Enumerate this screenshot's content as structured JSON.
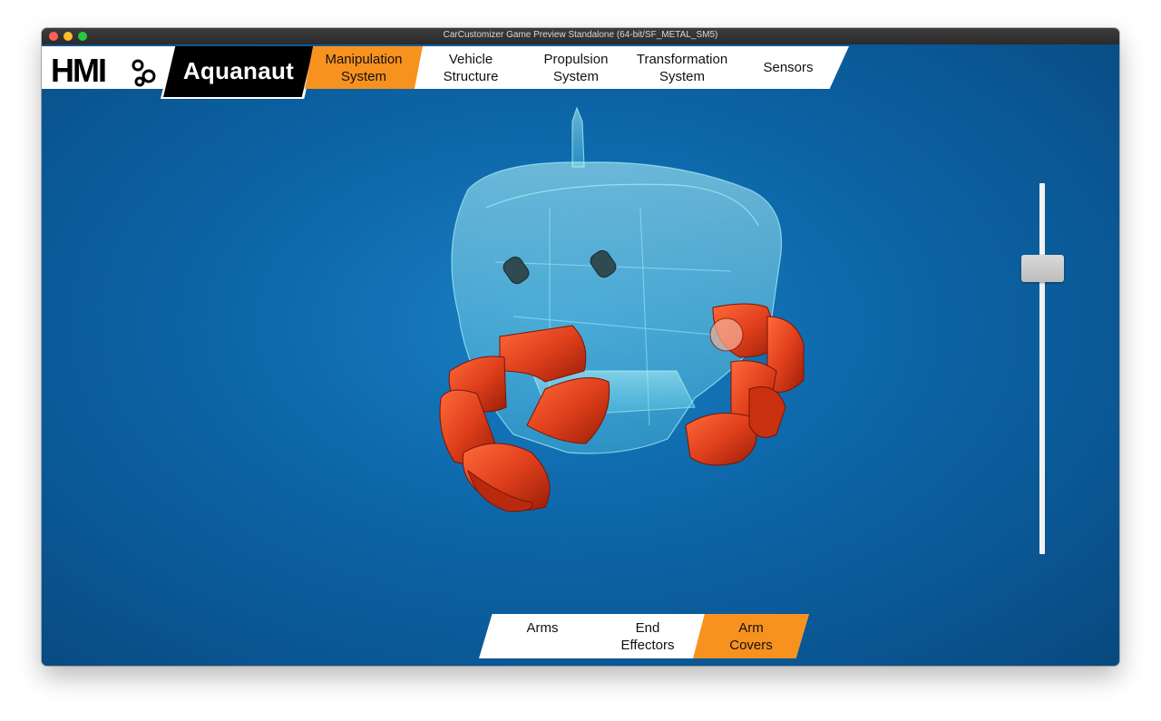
{
  "window": {
    "title": "CarCustomizer Game Preview Standalone (64-bit/SF_METAL_SM5)"
  },
  "header": {
    "logo_text": "HMI",
    "brand": "Aquanaut"
  },
  "top_tabs": [
    {
      "label": "Manipulation System",
      "active": true
    },
    {
      "label": "Vehicle Structure",
      "active": false
    },
    {
      "label": "Propulsion System",
      "active": false
    },
    {
      "label": "Transformation System",
      "active": false
    },
    {
      "label": "Sensors",
      "active": false
    }
  ],
  "bottom_tabs": [
    {
      "label": "Arms",
      "active": false
    },
    {
      "label": "End Effectors",
      "active": false
    },
    {
      "label": "Arm Covers",
      "active": true
    }
  ],
  "zoom_slider": {
    "value": 0.23
  },
  "colors": {
    "accent": "#f7921e",
    "background": "#0d67a9",
    "arm": "#e0401c",
    "hull": "#7fe6f0"
  }
}
